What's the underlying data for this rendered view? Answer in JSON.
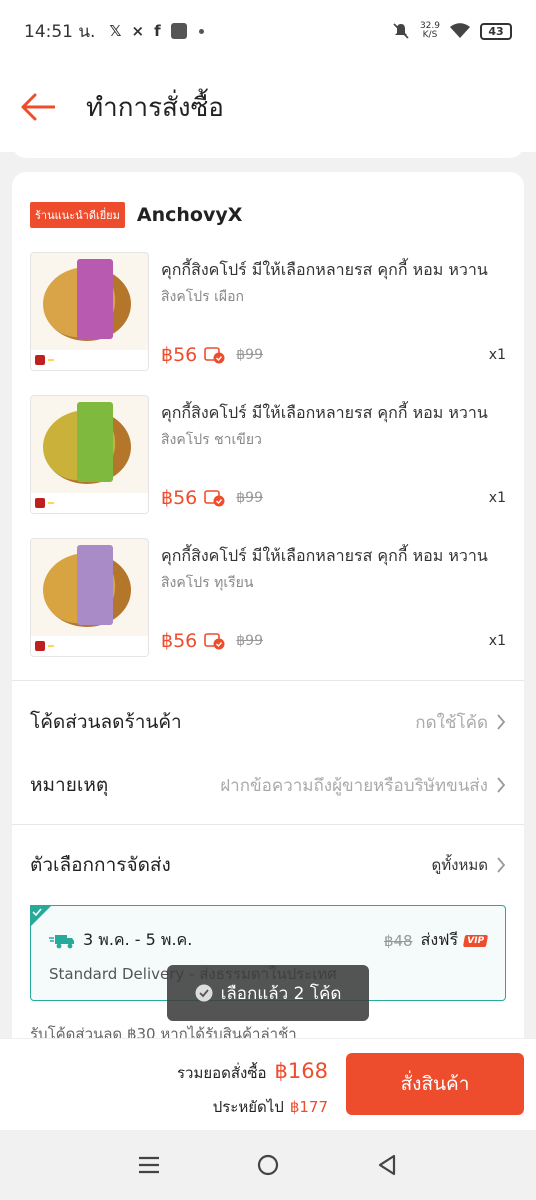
{
  "status": {
    "time": "14:51 น.",
    "speed_value": "32.9",
    "speed_unit": "K/S",
    "battery": "43"
  },
  "header": {
    "title": "ทำการสั่งซื้อ"
  },
  "shop": {
    "badge": "ร้านแนะนำดีเยี่ยม",
    "name": "AnchovyX"
  },
  "items": [
    {
      "name": "คุกกี้สิงคโปร์ มีให้เลือกหลายรส คุกกี้ หอม หวาน",
      "variant": "สิงคโปร เผือก",
      "price": "฿56",
      "old_price": "฿99",
      "qty": "x1",
      "box_color": "#b85ab0",
      "tray_color": "#d9a347"
    },
    {
      "name": "คุกกี้สิงคโปร์ มีให้เลือกหลายรส คุกกี้ หอม หวาน",
      "variant": "สิงคโปร ชาเขียว",
      "price": "฿56",
      "old_price": "฿99",
      "qty": "x1",
      "box_color": "#7fb93e",
      "tray_color": "#c9b13a"
    },
    {
      "name": "คุกกี้สิงคโปร์ มีให้เลือกหลายรส คุกกี้ หอม หวาน",
      "variant": "สิงคโปร ทุเรียน",
      "price": "฿56",
      "old_price": "฿99",
      "qty": "x1",
      "box_color": "#a98bc8",
      "tray_color": "#d8a441"
    }
  ],
  "shop_voucher": {
    "label": "โค้ดส่วนลดร้านค้า",
    "value": "กดใช้โค้ด"
  },
  "note": {
    "label": "หมายเหตุ",
    "placeholder": "ฝากข้อความถึงผู้ขายหรือบริษัทขนส่ง"
  },
  "shipping": {
    "label": "ตัวเลือกการจัดส่ง",
    "view_all": "ดูทั้งหมด",
    "dates": "3 พ.ค. - 5 พ.ค.",
    "old_fee": "฿48",
    "free": "ส่งฟรี",
    "vip": "VIP",
    "method": "Standard Delivery - ส่งธรรมดาในประเทศ"
  },
  "guarantee_text": "รับโค้ดส่วนลด ฿30 หากได้รับสินค้าล่าช้า",
  "toast": "เลือกแล้ว 2 โค้ด",
  "footer": {
    "total_label": "รวมยอดสั่งซื้อ",
    "total_value": "฿168",
    "saved_label": "ประหยัดไป",
    "saved_value": "฿177",
    "order_button": "สั่งสินค้า"
  },
  "colors": {
    "accent": "#ee4d2d",
    "teal": "#26aa99"
  },
  "icons": [
    "back-arrow-icon",
    "coin-icon",
    "truck-icon",
    "check-icon",
    "chevron-right-icon",
    "recents-icon",
    "home-icon",
    "back-icon"
  ]
}
